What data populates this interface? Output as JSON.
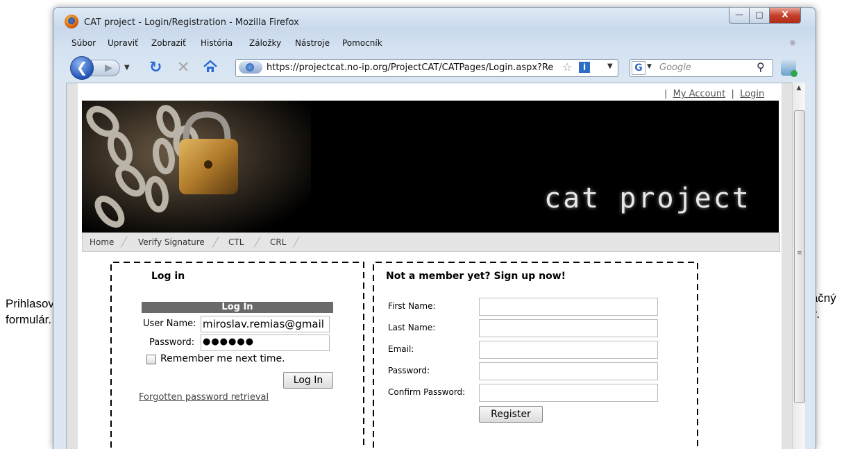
{
  "window": {
    "title": "CAT project - Login/Registration - Mozilla Firefox",
    "minimize_label": "—",
    "maximize_label": "□",
    "close_label": "X"
  },
  "menu": [
    {
      "label": "Súbor"
    },
    {
      "label": "Upraviť"
    },
    {
      "label": "Zobraziť"
    },
    {
      "label": "História"
    },
    {
      "label": "Záložky"
    },
    {
      "label": "Nástroje"
    },
    {
      "label": "Pomocník"
    }
  ],
  "toolbar": {
    "url": "https://projectcat.no-ip.org/ProjectCAT/CATPages/Login.aspx?Re",
    "search_placeholder": "Google",
    "search_engine_label": "G"
  },
  "site": {
    "top_links": {
      "my_account": "My Account",
      "login": "Login"
    },
    "banner_title": "cat project",
    "nav": [
      "Home",
      "Verify Signature",
      "CTL",
      "CRL"
    ]
  },
  "login": {
    "title": "Log in",
    "header": "Log In",
    "username_label": "User Name:",
    "username_value": "miroslav.remias@gmail",
    "password_label": "Password:",
    "password_value": "●●●●●●",
    "remember_label": "Remember me next time.",
    "submit_label": "Log In",
    "forgot_link": "Forgotten password retrieval"
  },
  "register": {
    "title": "Not a member yet? Sign up now!",
    "fields": [
      {
        "label": "First Name:"
      },
      {
        "label": "Last Name:"
      },
      {
        "label": "Email:"
      },
      {
        "label": "Password:"
      },
      {
        "label": "Confirm Password:"
      }
    ],
    "submit_label": "Register"
  },
  "annotations": {
    "left": [
      "Prihlasovací",
      "formulár."
    ],
    "right": [
      "Registračný",
      "formulár."
    ]
  }
}
